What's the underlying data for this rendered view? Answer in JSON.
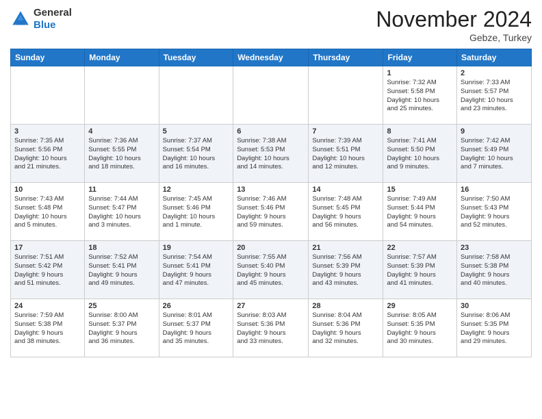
{
  "header": {
    "logo_line1": "General",
    "logo_line2": "Blue",
    "month_title": "November 2024",
    "location": "Gebze, Turkey"
  },
  "weekdays": [
    "Sunday",
    "Monday",
    "Tuesday",
    "Wednesday",
    "Thursday",
    "Friday",
    "Saturday"
  ],
  "weeks": [
    [
      {
        "day": "",
        "info": ""
      },
      {
        "day": "",
        "info": ""
      },
      {
        "day": "",
        "info": ""
      },
      {
        "day": "",
        "info": ""
      },
      {
        "day": "",
        "info": ""
      },
      {
        "day": "1",
        "info": "Sunrise: 7:32 AM\nSunset: 5:58 PM\nDaylight: 10 hours\nand 25 minutes."
      },
      {
        "day": "2",
        "info": "Sunrise: 7:33 AM\nSunset: 5:57 PM\nDaylight: 10 hours\nand 23 minutes."
      }
    ],
    [
      {
        "day": "3",
        "info": "Sunrise: 7:35 AM\nSunset: 5:56 PM\nDaylight: 10 hours\nand 21 minutes."
      },
      {
        "day": "4",
        "info": "Sunrise: 7:36 AM\nSunset: 5:55 PM\nDaylight: 10 hours\nand 18 minutes."
      },
      {
        "day": "5",
        "info": "Sunrise: 7:37 AM\nSunset: 5:54 PM\nDaylight: 10 hours\nand 16 minutes."
      },
      {
        "day": "6",
        "info": "Sunrise: 7:38 AM\nSunset: 5:53 PM\nDaylight: 10 hours\nand 14 minutes."
      },
      {
        "day": "7",
        "info": "Sunrise: 7:39 AM\nSunset: 5:51 PM\nDaylight: 10 hours\nand 12 minutes."
      },
      {
        "day": "8",
        "info": "Sunrise: 7:41 AM\nSunset: 5:50 PM\nDaylight: 10 hours\nand 9 minutes."
      },
      {
        "day": "9",
        "info": "Sunrise: 7:42 AM\nSunset: 5:49 PM\nDaylight: 10 hours\nand 7 minutes."
      }
    ],
    [
      {
        "day": "10",
        "info": "Sunrise: 7:43 AM\nSunset: 5:48 PM\nDaylight: 10 hours\nand 5 minutes."
      },
      {
        "day": "11",
        "info": "Sunrise: 7:44 AM\nSunset: 5:47 PM\nDaylight: 10 hours\nand 3 minutes."
      },
      {
        "day": "12",
        "info": "Sunrise: 7:45 AM\nSunset: 5:46 PM\nDaylight: 10 hours\nand 1 minute."
      },
      {
        "day": "13",
        "info": "Sunrise: 7:46 AM\nSunset: 5:46 PM\nDaylight: 9 hours\nand 59 minutes."
      },
      {
        "day": "14",
        "info": "Sunrise: 7:48 AM\nSunset: 5:45 PM\nDaylight: 9 hours\nand 56 minutes."
      },
      {
        "day": "15",
        "info": "Sunrise: 7:49 AM\nSunset: 5:44 PM\nDaylight: 9 hours\nand 54 minutes."
      },
      {
        "day": "16",
        "info": "Sunrise: 7:50 AM\nSunset: 5:43 PM\nDaylight: 9 hours\nand 52 minutes."
      }
    ],
    [
      {
        "day": "17",
        "info": "Sunrise: 7:51 AM\nSunset: 5:42 PM\nDaylight: 9 hours\nand 51 minutes."
      },
      {
        "day": "18",
        "info": "Sunrise: 7:52 AM\nSunset: 5:41 PM\nDaylight: 9 hours\nand 49 minutes."
      },
      {
        "day": "19",
        "info": "Sunrise: 7:54 AM\nSunset: 5:41 PM\nDaylight: 9 hours\nand 47 minutes."
      },
      {
        "day": "20",
        "info": "Sunrise: 7:55 AM\nSunset: 5:40 PM\nDaylight: 9 hours\nand 45 minutes."
      },
      {
        "day": "21",
        "info": "Sunrise: 7:56 AM\nSunset: 5:39 PM\nDaylight: 9 hours\nand 43 minutes."
      },
      {
        "day": "22",
        "info": "Sunrise: 7:57 AM\nSunset: 5:39 PM\nDaylight: 9 hours\nand 41 minutes."
      },
      {
        "day": "23",
        "info": "Sunrise: 7:58 AM\nSunset: 5:38 PM\nDaylight: 9 hours\nand 40 minutes."
      }
    ],
    [
      {
        "day": "24",
        "info": "Sunrise: 7:59 AM\nSunset: 5:38 PM\nDaylight: 9 hours\nand 38 minutes."
      },
      {
        "day": "25",
        "info": "Sunrise: 8:00 AM\nSunset: 5:37 PM\nDaylight: 9 hours\nand 36 minutes."
      },
      {
        "day": "26",
        "info": "Sunrise: 8:01 AM\nSunset: 5:37 PM\nDaylight: 9 hours\nand 35 minutes."
      },
      {
        "day": "27",
        "info": "Sunrise: 8:03 AM\nSunset: 5:36 PM\nDaylight: 9 hours\nand 33 minutes."
      },
      {
        "day": "28",
        "info": "Sunrise: 8:04 AM\nSunset: 5:36 PM\nDaylight: 9 hours\nand 32 minutes."
      },
      {
        "day": "29",
        "info": "Sunrise: 8:05 AM\nSunset: 5:35 PM\nDaylight: 9 hours\nand 30 minutes."
      },
      {
        "day": "30",
        "info": "Sunrise: 8:06 AM\nSunset: 5:35 PM\nDaylight: 9 hours\nand 29 minutes."
      }
    ]
  ]
}
